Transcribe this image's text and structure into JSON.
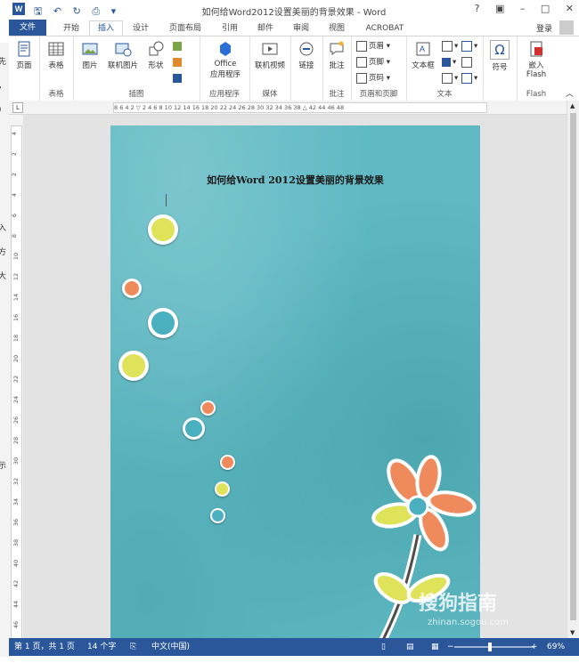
{
  "window": {
    "title": "如何给Word2012设置美丽的背景效果 - Word",
    "app_icon": "W",
    "controls": [
      "?",
      "▣",
      "–",
      "□",
      "✕"
    ]
  },
  "left_clip_text": [
    "先",
    "，",
    "）",
    "入",
    "方",
    "大",
    "示"
  ],
  "tabs": [
    {
      "label": "文件"
    },
    {
      "label": "开始"
    },
    {
      "label": "插入"
    },
    {
      "label": "设计"
    },
    {
      "label": "页面布局"
    },
    {
      "label": "引用"
    },
    {
      "label": "邮件"
    },
    {
      "label": "审阅"
    },
    {
      "label": "视图"
    },
    {
      "label": "ACROBAT"
    }
  ],
  "signin": "登录",
  "ribbon": {
    "pages": {
      "label": "页面",
      "group": ""
    },
    "tables": {
      "label": "表格",
      "group": "表格"
    },
    "illustrations": {
      "group": "插图",
      "picture": "图片",
      "online_picture": "联机图片",
      "shapes": "形状"
    },
    "apps": {
      "group": "应用程序",
      "office": "Office",
      "office2": "应用程序"
    },
    "media": {
      "group": "媒体",
      "video": "联机视频"
    },
    "links": {
      "label": "链接"
    },
    "comments": {
      "group": "批注",
      "comment": "批注"
    },
    "header_footer": {
      "group": "页眉和页脚",
      "header": "页眉",
      "footer": "页脚",
      "page_number": "页码"
    },
    "text": {
      "group": "文本",
      "textbox": "文本框"
    },
    "symbols": {
      "label": "符号",
      "omega": "Ω"
    },
    "flash": {
      "group": "Flash",
      "embed": "嵌入",
      "embed2": "Flash"
    }
  },
  "ruler": {
    "h_ticks": "8  6  4  2  ▽  2  4  6  8  10  12  14  16  18  20  22  24  26  28  30  32  34  36  38  △  42  44  46  48",
    "v_ticks": [
      "4",
      "2",
      "2",
      "4",
      "6",
      "8",
      "10",
      "12",
      "14",
      "16",
      "18",
      "20",
      "22",
      "24",
      "26",
      "28",
      "30",
      "32",
      "34",
      "36",
      "38",
      "40",
      "42",
      "44",
      "46"
    ]
  },
  "document": {
    "title": "如何给Word 2012设置美丽的背景效果"
  },
  "status": {
    "page": "第 1 页，共 1 页",
    "words": "14 个字",
    "language": "中文(中国)",
    "zoom": "69%",
    "zoom_minus": "−",
    "zoom_plus": "+"
  },
  "watermark": {
    "brand": "搜狗指南",
    "url": "zhinan.sogou.com"
  },
  "colors": {
    "accent": "#2b579a",
    "page_bg": "#5fb9c3"
  }
}
